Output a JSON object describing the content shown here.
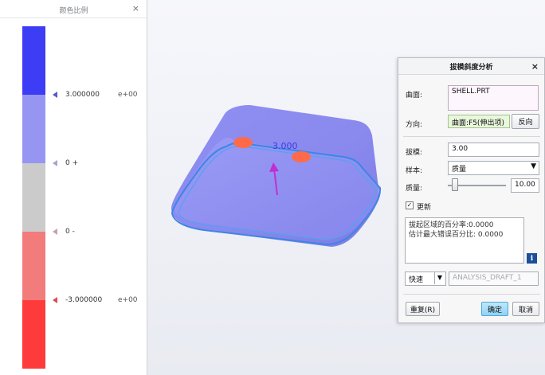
{
  "scale_panel": {
    "title": "颜色比例",
    "close": "×",
    "segments": [
      "#3d3df5",
      "#9696f2",
      "#cbcbcc",
      "#f27c7c",
      "#ff3a3a"
    ],
    "ticks": [
      {
        "value": "3.000000",
        "exp": "e+00",
        "marker_color": "#5a56c9"
      },
      {
        "value": "0 +",
        "exp": "",
        "marker_color": "#a7a4c9"
      },
      {
        "value": "0 -",
        "exp": "",
        "marker_color": "#c4a3a8"
      },
      {
        "value": "-3.000000",
        "exp": "e+00",
        "marker_color": "#e04a55"
      }
    ]
  },
  "viewport": {
    "draft_value": "3.000",
    "part_color": "#8d8cf1",
    "edge_color": "#2f7fe0",
    "hotspot_color": "#ff6b4a",
    "arrow_color": "#c02fd0"
  },
  "dialog": {
    "title": "拔模斜度分析",
    "close": "×",
    "surface_label": "曲面:",
    "surface_value": "SHELL.PRT",
    "direction_label": "方向:",
    "direction_value": "曲面:F5(伸出项)",
    "flip_button": "反向",
    "draft_label": "拔模:",
    "draft_value": "3.00",
    "sample_label": "样本:",
    "sample_value": "质量",
    "quality_label": "质量:",
    "quality_value": "10.00",
    "quality_level": 0.12,
    "update_label": "更新",
    "update_checked": true,
    "result_line1": "拔起区域的百分率:0.0000",
    "result_line2": "估计最大错误百分比: 0.0000",
    "info_icon": "i",
    "mode_value": "快速",
    "analysis_name": "ANALYSIS_DRAFT_1",
    "repeat_button": "重复(R)",
    "ok_button": "确定",
    "cancel_button": "取消"
  }
}
